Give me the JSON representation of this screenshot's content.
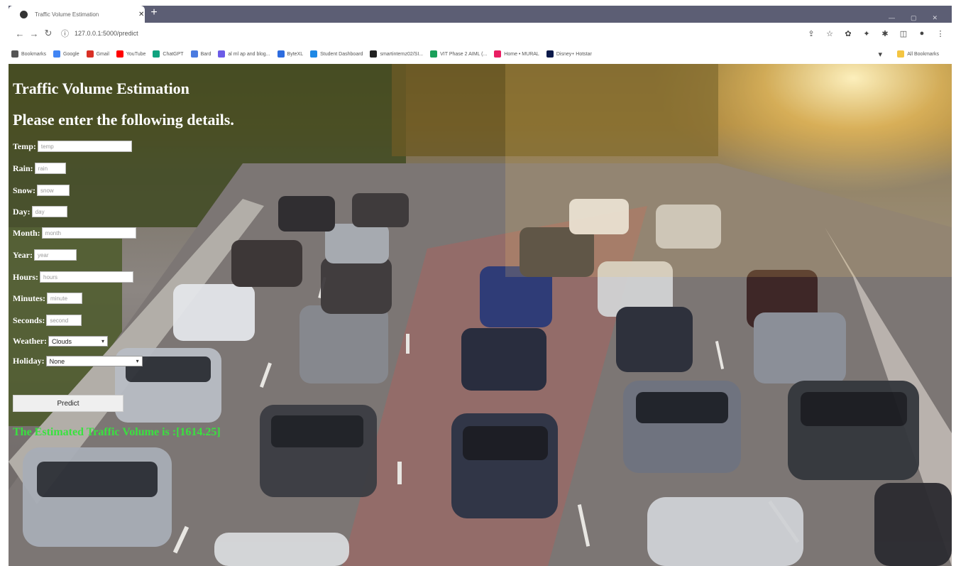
{
  "browser": {
    "tab_title": "Traffic Volume Estimation",
    "new_tab_label": "+",
    "url": "127.0.0.1:5000/predict",
    "bookmarks": [
      {
        "label": "Bookmarks",
        "color": "#555555"
      },
      {
        "label": "Google",
        "color": "#4285f4"
      },
      {
        "label": "Gmail",
        "color": "#d93025"
      },
      {
        "label": "YouTube",
        "color": "#ff0000"
      },
      {
        "label": "ChatGPT",
        "color": "#10a37f"
      },
      {
        "label": "Bard",
        "color": "#4a7be0"
      },
      {
        "label": "al ml ap and blog...",
        "color": "#6c5ce7"
      },
      {
        "label": "ByteXL",
        "color": "#2d6cdf"
      },
      {
        "label": "Student Dashboard",
        "color": "#1e88e5"
      },
      {
        "label": "smartinternz02/SI...",
        "color": "#222222"
      },
      {
        "label": "VIT Phase 2 AIML (...",
        "color": "#1aa05a"
      },
      {
        "label": "Home • MURAL",
        "color": "#e91e63"
      },
      {
        "label": "Disney+ Hotstar",
        "color": "#0c1a4a"
      }
    ],
    "all_bookmarks_label": "All Bookmarks"
  },
  "page": {
    "title": "Traffic Volume Estimation",
    "subtitle": "Please enter the following details.",
    "fields": {
      "temp": {
        "label": "Temp:",
        "placeholder": "temp"
      },
      "rain": {
        "label": "Rain:",
        "placeholder": "rain"
      },
      "snow": {
        "label": "Snow:",
        "placeholder": "snow"
      },
      "day": {
        "label": "Day:",
        "placeholder": "day"
      },
      "month": {
        "label": "Month:",
        "placeholder": "month"
      },
      "year": {
        "label": "Year:",
        "placeholder": "year"
      },
      "hours": {
        "label": "Hours:",
        "placeholder": "hours"
      },
      "minutes": {
        "label": "Minutes:",
        "placeholder": "minute"
      },
      "seconds": {
        "label": "Seconds:",
        "placeholder": "second"
      }
    },
    "weather": {
      "label": "Weather:",
      "selected": "Clouds"
    },
    "holiday": {
      "label": "Holiday:",
      "selected": "None"
    },
    "predict_label": "Predict",
    "result_text": "The Estimated Traffic Volume is :[1614.25]"
  }
}
